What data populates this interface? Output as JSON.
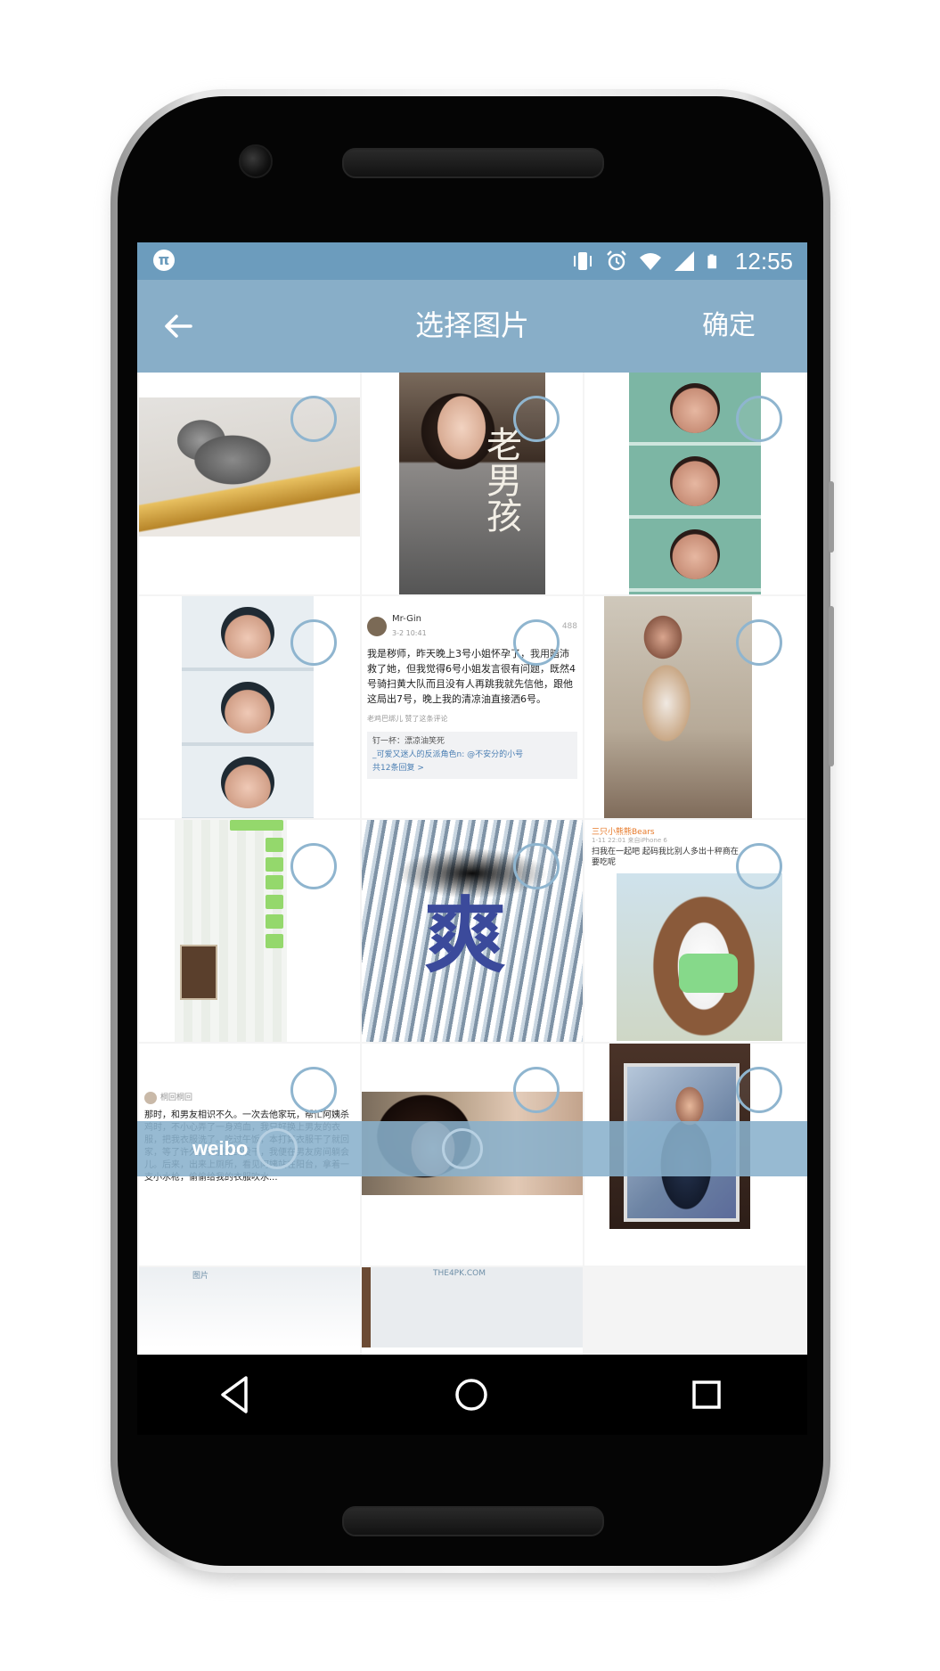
{
  "statusbar": {
    "app_glyph": "π",
    "time": "12:55",
    "icons": [
      "vibrate-icon",
      "alarm-icon",
      "wifi-icon",
      "signal-icon",
      "battery-icon"
    ]
  },
  "appbar": {
    "title": "选择图片",
    "confirm_label": "确定",
    "back_icon": "arrow-left-icon"
  },
  "grid": {
    "poster_text": "老男孩",
    "post": {
      "author": "Mr-Gin",
      "time": "3-2 10:41",
      "count": "488",
      "body": "我是秽师，昨天晚上3号小姐怀孕了，我用暗沛救了她，但我觉得6号小姐发言很有问题，既然4号骑扫黄大队而且没有人再跳我就先信他，跟他这局出7号，晚上我的清凉油直接洒6号。",
      "like_line": "老鸡巴绑儿 赞了这条评论",
      "quote_line1": "钉一杯：漂凉油笑死",
      "quote_line2": "_可爱又迷人的反派角色n: @不安分的小号",
      "quote_more": "共12条回复 >"
    },
    "water_char": "爽",
    "bear": {
      "author": "三只小熊熊Bears",
      "time": "1-11 22:01 来自iPhone 6",
      "body": "扫我在一起吧 起码我比别人多出十秤商在要吃呢"
    },
    "weibo_text": {
      "author": "桐回桐回",
      "body": "那时，和男友相识不久。一次去他家玩，帮忙阿姨杀鸡时，不小心弄了一身鸡血，我只好换上男友的衣服，把我衣服洗了。吃过午饭，本打算衣服干了就回家，等了许久，衣服始终没干，我便在男友房间躺会儿。后来，出来上厕所，看见阿姨站在阳台，拿着一支小水枪，偷偷给我的衣服吹水..."
    },
    "last_label": "图片",
    "last_site": "THE4PK.COM"
  },
  "bottombar": {
    "label": "weibo"
  },
  "navbar": {
    "buttons": [
      "back-triangle-icon",
      "home-circle-icon",
      "recents-square-icon"
    ]
  },
  "colors": {
    "statusbar": "#6c9cbd",
    "appbar": "#88aec8",
    "select_circle": "#8fb5cf",
    "background": "#f4f4f4"
  }
}
